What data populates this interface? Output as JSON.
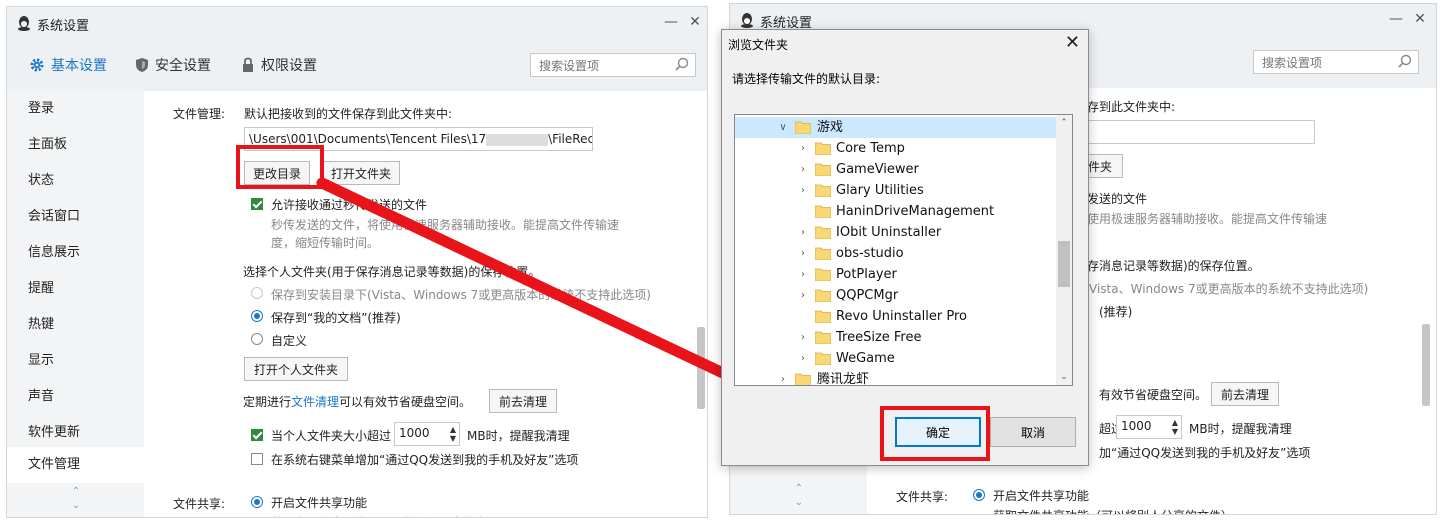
{
  "window": {
    "title": "系统设置"
  },
  "tabs": [
    {
      "label": "基本设置"
    },
    {
      "label": "安全设置"
    },
    {
      "label": "权限设置"
    }
  ],
  "search": {
    "placeholder": "搜索设置项"
  },
  "sidebar": {
    "items": [
      "登录",
      "主面板",
      "状态",
      "会话窗口",
      "信息展示",
      "提醒",
      "热键",
      "显示",
      "声音",
      "软件更新",
      "文件管理"
    ],
    "active": "文件管理"
  },
  "file_mgmt": {
    "section_label": "文件管理:",
    "default_desc": "默认把接收到的文件保存到此文件夹中:",
    "path_prefix": "\\Users\\001\\Documents\\Tencent Files\\17",
    "path_suffix": "\\FileRecv\\",
    "change_dir_button": "更改目录",
    "open_folder_button": "打开文件夹",
    "allow_fast_label": "允许接收通过秒传发送的文件",
    "allow_fast_desc_1": "秒传发送的文件，将使用极速服务器辅助接收。能提高文件传输速",
    "allow_fast_desc_2": "度，缩短传输时间。",
    "personal_folder_title": "选择个人文件夹(用于保存消息记录等数据)的保存位置。",
    "radio_install_dir": "保存到安装目录下(Vista、Windows 7或更高版本的系统不支持此选项)",
    "radio_my_docs": "保存到“我的文档”(推荐)",
    "radio_custom": "自定义",
    "open_personal_button": "打开个人文件夹",
    "cleanup_pre": "定期进行",
    "cleanup_link": "文件清理",
    "cleanup_post": "可以有效节省硬盘空间。",
    "cleanup_button": "前去清理",
    "size_warn_pre": "当个人文件夹大小超过",
    "size_value": "1000",
    "size_warn_post": "MB时，提醒我清理",
    "context_menu_label": "在系统右键菜单增加“通过QQ发送到我的手机及好友”选项",
    "share_label": "文件共享:",
    "share_enable": "开启文件共享功能",
    "share_next": "获取文件共享功能（可以将别人分享的文件）"
  },
  "right_partial": {
    "desc_tail": "存到此文件夹中:",
    "btn_tail": "件夹",
    "fast_tail": "发送的文件",
    "fast_desc_tail": "使用极速服务器辅助接收。能提高文件传输速",
    "personal_tail": "存消息记录等数据)的保存位置。",
    "install_tail": "Vista、Windows 7或更高版本的系统不支持此选项)",
    "mydocs_tail": "(推荐)",
    "cleanup_tail": "有效节省硬盘空间。",
    "size_pre_tail": "超过",
    "context_tail": "加“通过QQ发送到我的手机及好友”选项"
  },
  "dialog": {
    "title": "浏览文件夹",
    "prompt": "请选择传输文件的默认目录:",
    "selected": "游戏",
    "folders": [
      "Core Temp",
      "GameViewer",
      "Glary Utilities",
      "HaninDriveManagement",
      "IObit Uninstaller",
      "obs-studio",
      "PotPlayer",
      "QQPCMgr",
      "Revo Uninstaller Pro",
      "TreeSize Free",
      "WeGame"
    ],
    "expandable": [
      true,
      true,
      true,
      false,
      true,
      true,
      true,
      true,
      false,
      true,
      true
    ],
    "last_folder": "腾讯龙虾",
    "ok_button": "确定",
    "cancel_button": "取消"
  },
  "colors": {
    "accent": "#1b76c8",
    "annotation": "#e8141a",
    "check": "#2e8b3d"
  }
}
